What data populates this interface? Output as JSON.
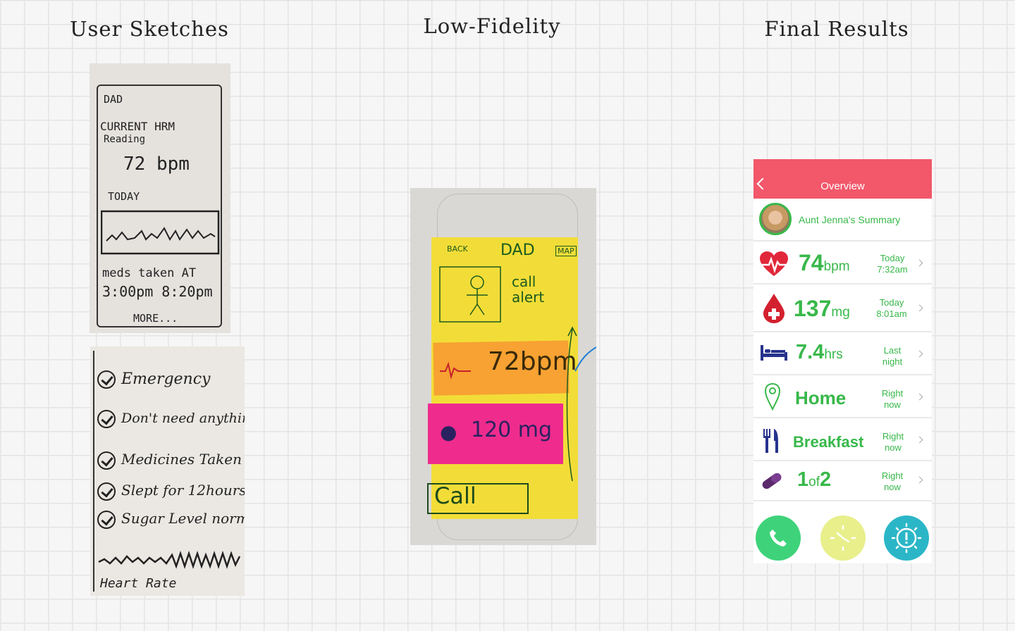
{
  "columns": {
    "sketches": "User Sketches",
    "lofi": "Low-Fidelity",
    "final": "Final Results"
  },
  "sketch1": {
    "line1": "DAD",
    "line2": "CURRENT HRM",
    "line3": "Reading",
    "line4": "72 bpm",
    "line5": "TODAY",
    "line6": "meds taken AT",
    "line7": "3:00pm 8:20pm",
    "line8": "MORE..."
  },
  "sketch2": {
    "items": [
      "Emergency",
      "Don't need anything",
      "Medicines Taken",
      "Slept for 12hours",
      "Sugar Level normal"
    ],
    "footer": "Heart Rate"
  },
  "lofi": {
    "back": "BACK",
    "name": "DAD",
    "map": "MAP",
    "call_alert": "call alert",
    "hr": "72bpm",
    "sugar": "120 mg",
    "call": "Call"
  },
  "final": {
    "header_title": "Overview",
    "summary": "Aunt Jenna's Summary",
    "rows": [
      {
        "value": "74",
        "unit": "bpm",
        "when1": "Today",
        "when2": "7:32am",
        "icon": "heart-rate-icon"
      },
      {
        "value": "137",
        "unit": "mg",
        "when1": "Today",
        "when2": "8:01am",
        "icon": "blood-drop-icon"
      },
      {
        "value": "7.4",
        "unit": "hrs",
        "when1": "Last",
        "when2": "night",
        "icon": "bed-icon"
      },
      {
        "value": "Home",
        "unit": "",
        "when1": "Right",
        "when2": "now",
        "icon": "location-pin-icon"
      },
      {
        "value": "Breakfast",
        "unit": "",
        "when1": "Right",
        "when2": "now",
        "icon": "fork-knife-icon"
      },
      {
        "value": "1",
        "unit": "of",
        "value2": "2",
        "when1": "Right",
        "when2": "now",
        "icon": "pill-icon"
      }
    ],
    "colors": {
      "header": "#f2576a",
      "accent": "#38b84a",
      "call": "#3ed37a",
      "clock": "#e8ef8b",
      "alert": "#2bb6c7"
    }
  }
}
